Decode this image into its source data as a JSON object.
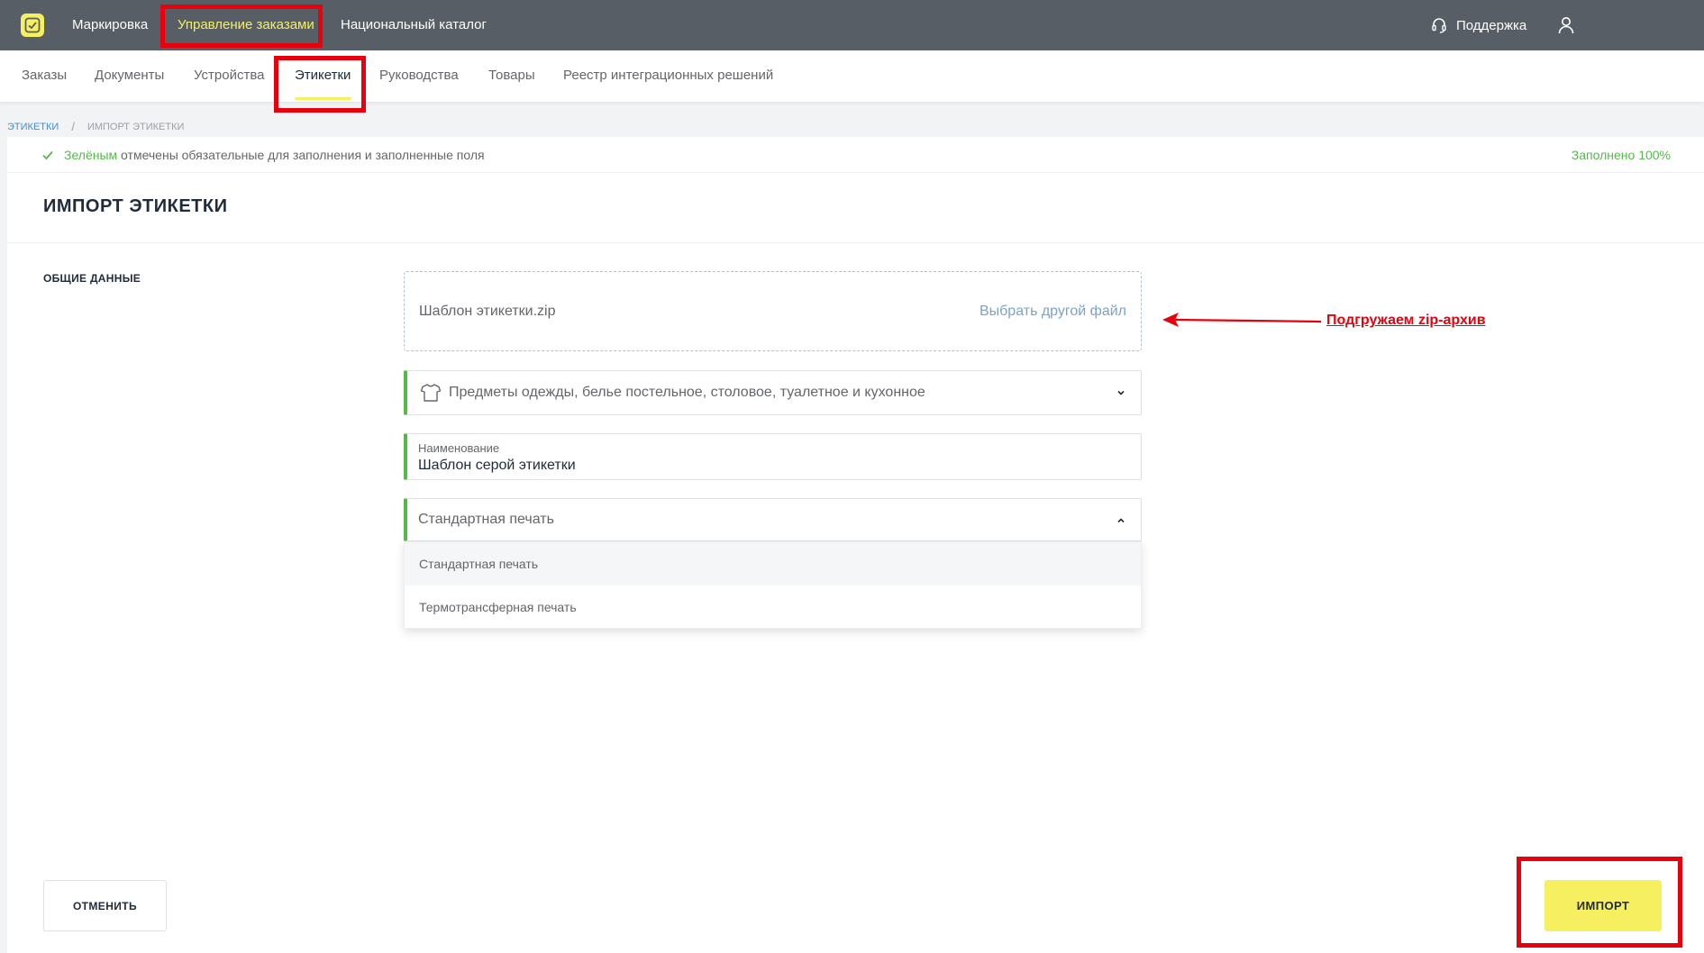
{
  "topnav": {
    "items": [
      "Маркировка",
      "Управление заказами",
      "Национальный каталог"
    ],
    "support": "Поддержка"
  },
  "subnav": {
    "items": [
      "Заказы",
      "Документы",
      "Устройства",
      "Этикетки",
      "Руководства",
      "Товары",
      "Реестр интеграционных решений"
    ]
  },
  "breadcrumb": {
    "root": "ЭТИКЕТКИ",
    "separator": "/",
    "current": "ИМПОРТ ЭТИКЕТКИ"
  },
  "info": {
    "green_word": "Зелёным",
    "text": "отмечены обязательные для заполнения и заполненные поля",
    "filled": "Заполнено 100%"
  },
  "page": {
    "title": "ИМПОРТ ЭТИКЕТКИ",
    "section": "ОБЩИЕ ДАННЫЕ"
  },
  "file": {
    "name": "Шаблон этикетки.zip",
    "change": "Выбрать другой файл"
  },
  "category": {
    "value": "Предметы одежды, белье постельное, столовое, туалетное и кухонное",
    "icon": "shirt-icon"
  },
  "name_field": {
    "label": "Наименование",
    "value": "Шаблон серой этикетки"
  },
  "print_type": {
    "value": "Стандартная печать",
    "options": [
      "Стандартная печать",
      "Термотрансферная печать"
    ]
  },
  "buttons": {
    "cancel": "ОТМЕНИТЬ",
    "import": "ИМПОРТ"
  },
  "annotation": {
    "text": "Подгружаем zip-архив",
    "color": "#e8000d"
  },
  "colors": {
    "accent": "#f6f060",
    "topbar": "#585e66",
    "green": "#55b94a",
    "link": "#3f8ed6"
  }
}
